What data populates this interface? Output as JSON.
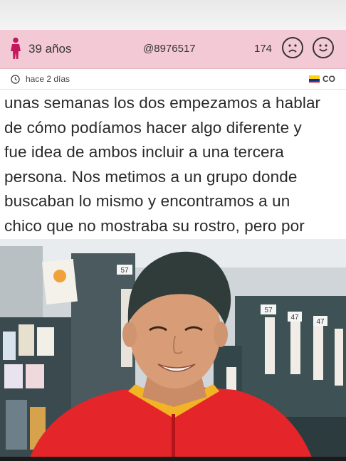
{
  "header": {
    "age": "39 años",
    "username": "@8976517",
    "count": "174",
    "sad_icon": "sad-face-icon",
    "happy_icon": "happy-face-icon",
    "person_icon": "person-icon",
    "bg_color": "#f4c9d6"
  },
  "meta": {
    "time_ago": "hace 2 días",
    "country": "CO",
    "clock_icon": "clock-icon",
    "flag_icon": "colombia-flag-icon"
  },
  "post": {
    "lines": [
      "unas semanas los dos empezamos a hablar",
      "de cómo podíamos hacer algo diferente y",
      "fue idea de ambos incluir a una tercera",
      "persona. Nos metimos a un grupo donde",
      "buscaban lo mismo y encontramos a un",
      "chico que no mostraba su rostro, pero por"
    ]
  },
  "photo": {
    "shelf_tags": [
      "57",
      "57",
      "47",
      "47"
    ]
  }
}
